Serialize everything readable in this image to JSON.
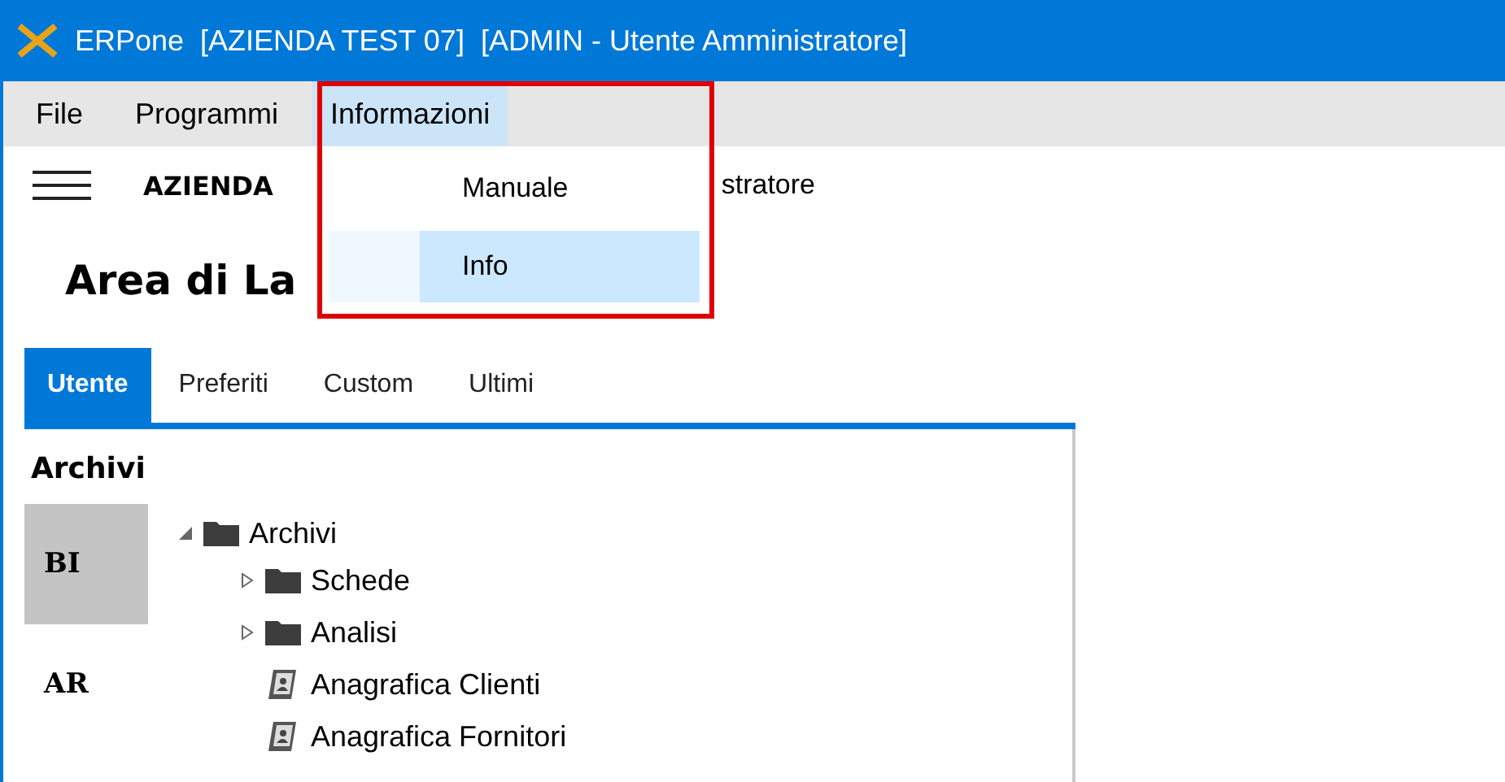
{
  "window": {
    "title": "ERPone  [AZIENDA TEST 07]  [ADMIN - Utente Amministratore]"
  },
  "menu_bar": [
    {
      "label": "File",
      "selected": false
    },
    {
      "label": "Programmi",
      "selected": false
    },
    {
      "label": "Informazioni",
      "selected": true
    }
  ],
  "menu_dropdown": [
    {
      "label": "Manuale",
      "selected": false
    },
    {
      "label": "Info",
      "selected": true
    }
  ],
  "header": {
    "company": "AZIENDA",
    "user": "stratore"
  },
  "page_title": "Area di La",
  "tabs": [
    {
      "label": "Utente",
      "selected": true
    },
    {
      "label": "Preferiti",
      "selected": false
    },
    {
      "label": "Custom",
      "selected": false
    },
    {
      "label": "Ultimi",
      "selected": false
    }
  ],
  "section_title": "Archivi",
  "side_rail": [
    {
      "label": "BI",
      "selected": true
    },
    {
      "label": "AR",
      "selected": false
    }
  ],
  "tree": [
    {
      "label": "Archivi",
      "kind": "folder",
      "expanded": true,
      "children": [
        {
          "label": "Schede",
          "kind": "folder",
          "expanded": false
        },
        {
          "label": "Analisi",
          "kind": "folder",
          "expanded": false
        },
        {
          "label": "Anagrafica Clienti",
          "kind": "item"
        },
        {
          "label": "Anagrafica Fornitori",
          "kind": "item"
        }
      ]
    }
  ]
}
